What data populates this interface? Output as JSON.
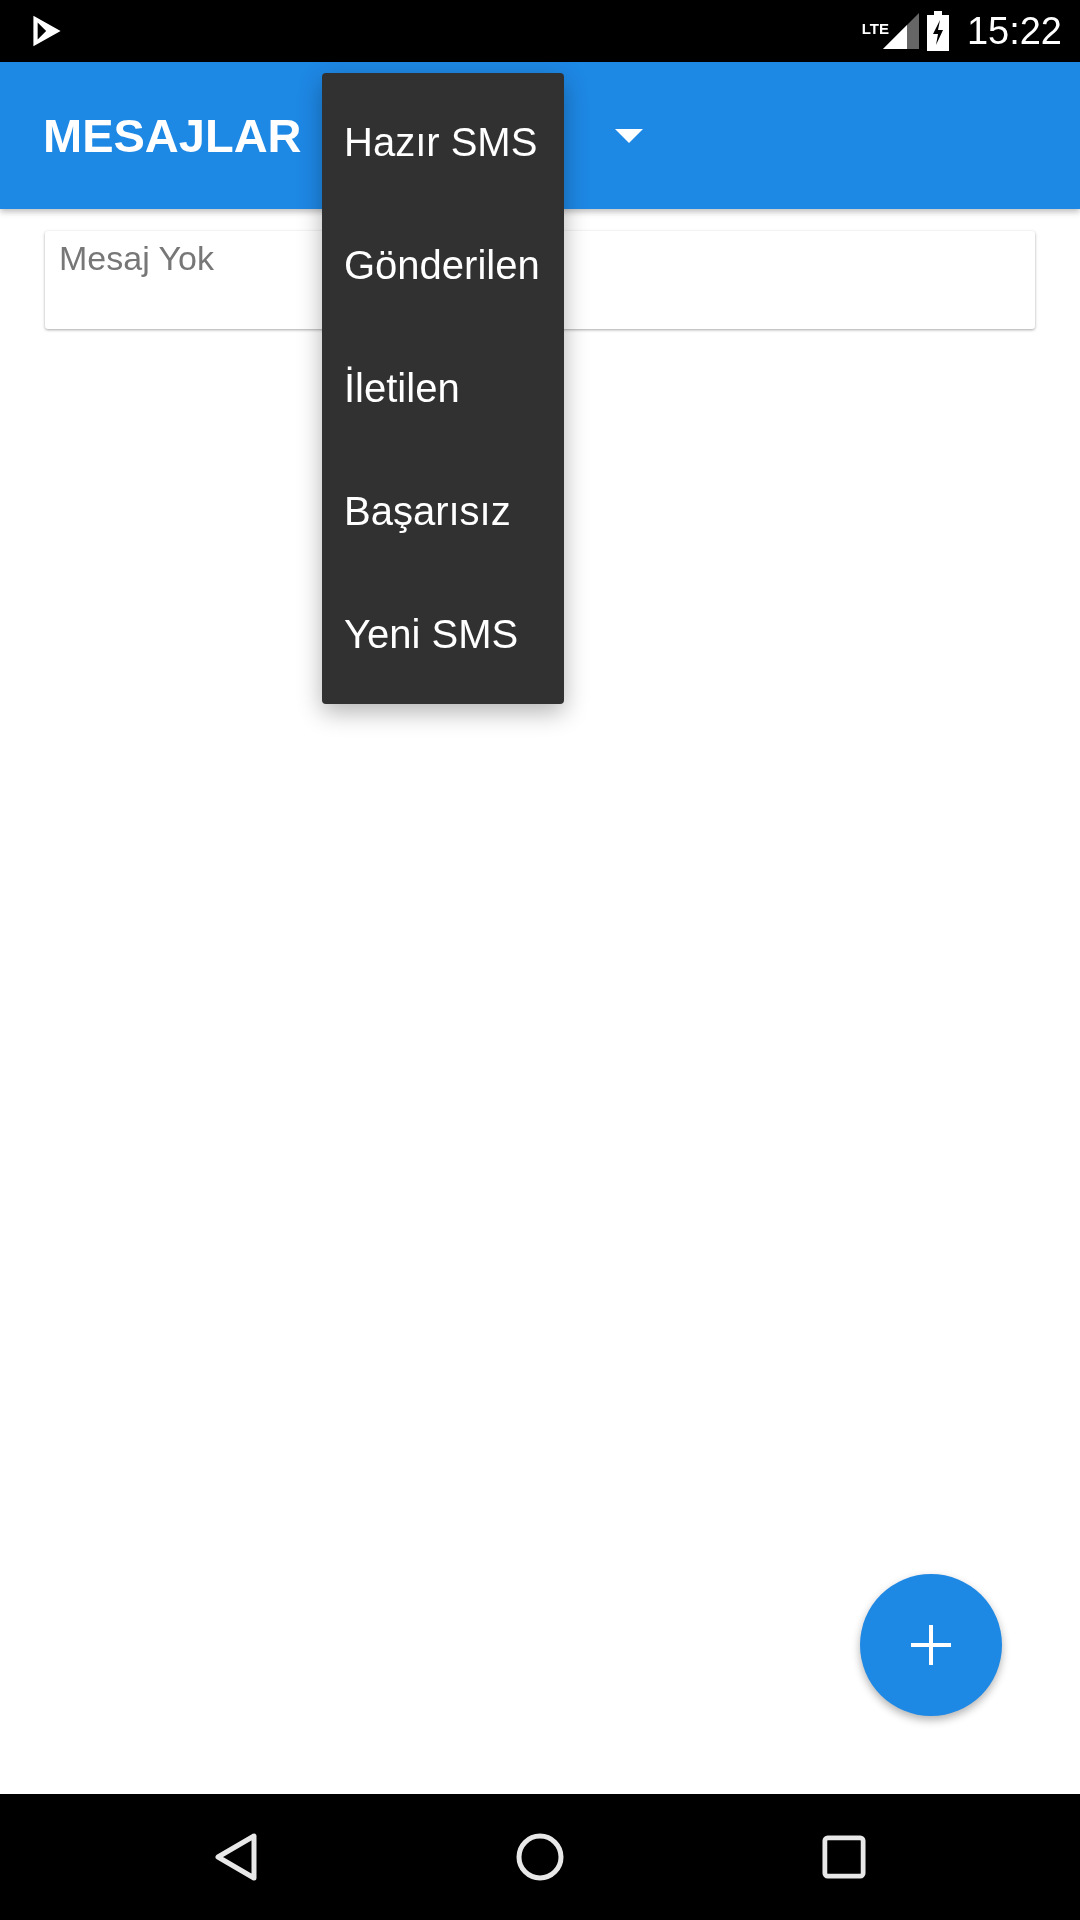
{
  "status_bar": {
    "network": "LTE",
    "time": "15:22"
  },
  "app_bar": {
    "title": "MESAJLAR"
  },
  "message_card": {
    "text": "Mesaj Yok"
  },
  "dropdown_menu": {
    "items": [
      {
        "label": "Hazır SMS"
      },
      {
        "label": "Gönderilen"
      },
      {
        "label": "İletilen"
      },
      {
        "label": "Başarısız"
      },
      {
        "label": "Yeni SMS"
      }
    ]
  }
}
